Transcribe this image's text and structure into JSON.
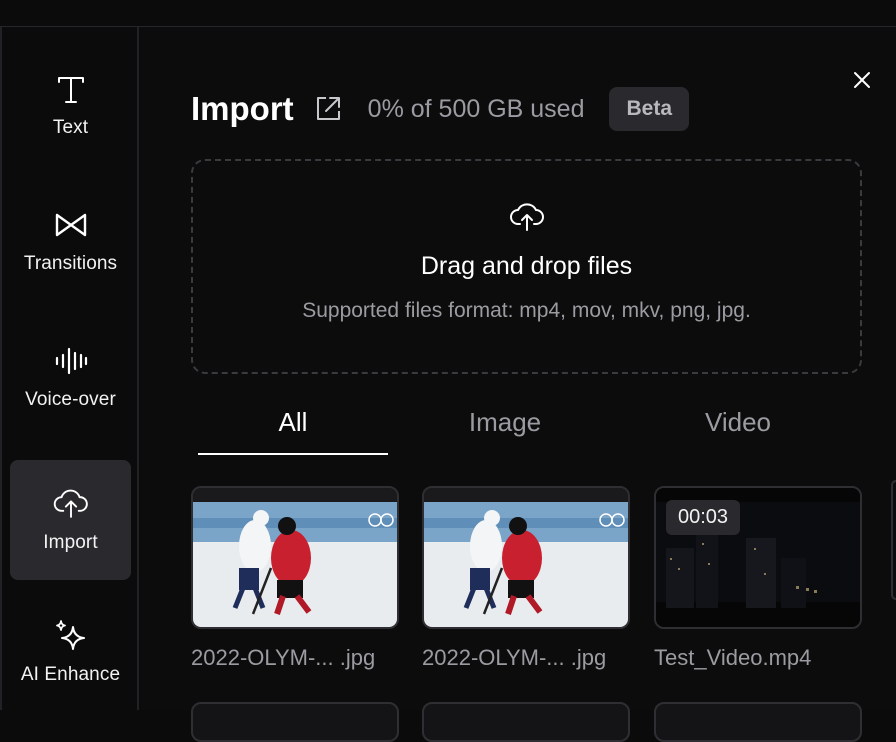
{
  "sidebar": {
    "items": [
      {
        "label": "Text",
        "icon": "text-icon"
      },
      {
        "label": "Transitions",
        "icon": "transitions-icon"
      },
      {
        "label": "Voice-over",
        "icon": "waveform-icon"
      },
      {
        "label": "Import",
        "icon": "cloud-upload-icon",
        "active": true
      },
      {
        "label": "AI Enhance",
        "icon": "sparkles-icon"
      }
    ]
  },
  "header": {
    "title": "Import",
    "storage": "0% of 500 GB used",
    "badge": "Beta"
  },
  "dropzone": {
    "title": "Drag and drop files",
    "subtitle": "Supported files format: mp4, mov, mkv, png, jpg."
  },
  "tabs": [
    {
      "label": "All",
      "active": true
    },
    {
      "label": "Image",
      "active": false
    },
    {
      "label": "Video",
      "active": false
    }
  ],
  "files": [
    {
      "name": "2022-OLYM-... .jpg",
      "type": "image"
    },
    {
      "name": "2022-OLYM-... .jpg",
      "type": "image"
    },
    {
      "name": "Test_Video.mp4",
      "type": "video",
      "duration": "00:03"
    }
  ],
  "colors": {
    "background": "#0b0b0c",
    "active_item": "#2a2a2e",
    "muted_text": "#9b9ba1",
    "border": "#2f2f33"
  }
}
